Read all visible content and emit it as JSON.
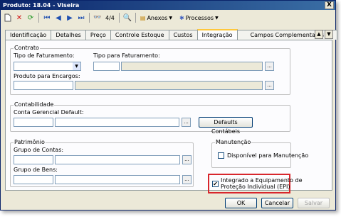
{
  "window": {
    "title": "Produto: 18.04 - Viseira",
    "close_label": "X"
  },
  "toolbar": {
    "record_counter": "4/4",
    "anexos_label": "Anexos",
    "processos_label": "Processos"
  },
  "tabs": [
    {
      "label": "Identificação"
    },
    {
      "label": "Detalhes"
    },
    {
      "label": "Preço"
    },
    {
      "label": "Controle Estoque"
    },
    {
      "label": "Custos"
    },
    {
      "label": "Integração",
      "active": true
    },
    {
      "label": "Campos Complementares"
    }
  ],
  "contrato": {
    "legend": "Contrato",
    "tipo_faturamento_label": "Tipo de Faturamento:",
    "tipo_para_faturamento_label": "Tipo para Faturamento:",
    "produto_encargos_label": "Produto para Encargos:"
  },
  "contabilidade": {
    "legend": "Contabilidade",
    "conta_gerencial_label": "Conta Gerencial Default:",
    "defaults_button": "Defaults Contábeis"
  },
  "patrimonio": {
    "legend": "Patrimônio",
    "grupo_contas_label": "Grupo de Contas:",
    "grupo_bens_label": "Grupo de Bens:"
  },
  "manutencao": {
    "legend": "Manutenção",
    "disponivel_label": "Disponível para Manutenção",
    "disponivel_checked": false
  },
  "epi": {
    "line1": "Integrado a Equipamento de",
    "line2": "Proteção Individual (EPI)",
    "checked": true,
    "highlight_color": "#d8262c"
  },
  "footer": {
    "ok_label": "OK",
    "cancelar_label": "Cancelar",
    "salvar_label": "Salvar"
  },
  "dots_label": "..."
}
